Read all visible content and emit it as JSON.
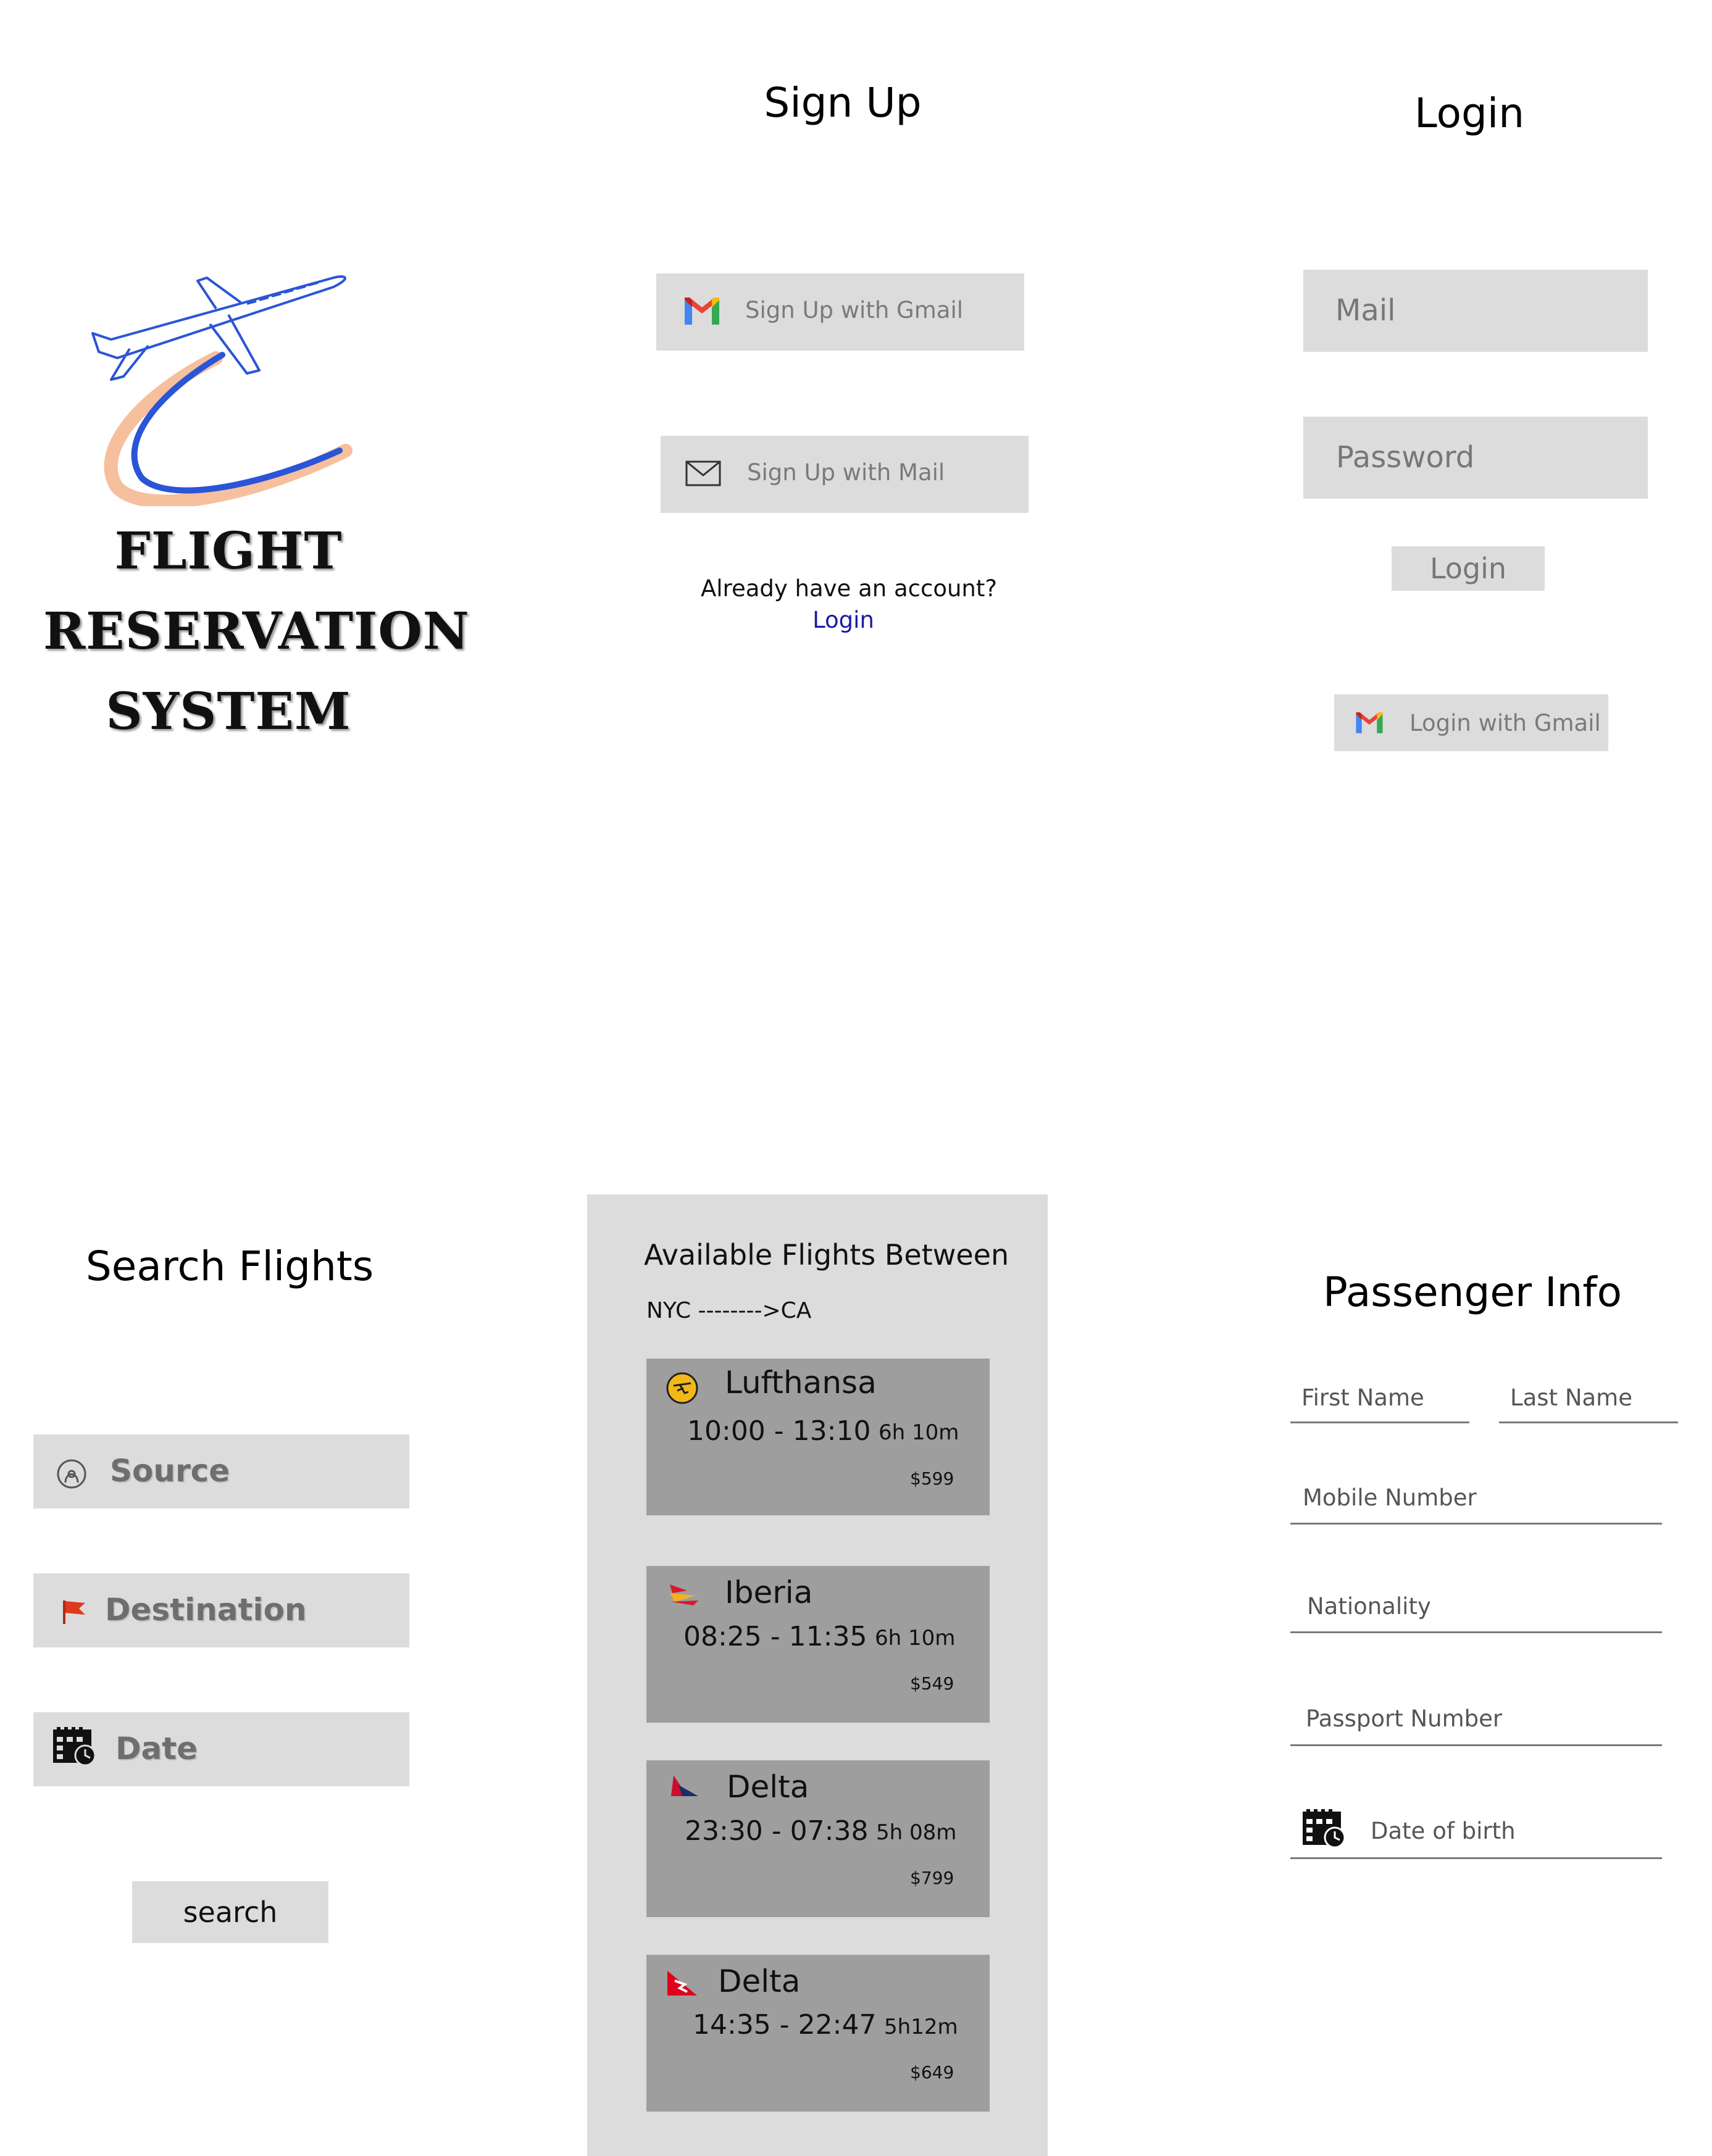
{
  "brand": {
    "line1": "FLIGHT",
    "line2": "RESERVATION",
    "line3": "SYSTEM"
  },
  "signup": {
    "title": "Sign Up",
    "gmail_label": "Sign Up with Gmail",
    "mail_label": "Sign Up with Mail",
    "already_text": "Already have an account?",
    "login_link": "Login"
  },
  "login": {
    "title": "Login",
    "mail_placeholder": "Mail",
    "password_placeholder": "Password",
    "login_button": "Login",
    "gmail_label": "Login with Gmail"
  },
  "search": {
    "title": "Search Flights",
    "source_label": "Source",
    "destination_label": "Destination",
    "date_label": "Date",
    "search_button": "search"
  },
  "flights": {
    "heading": "Available Flights Between",
    "route": "NYC -------->CA",
    "items": [
      {
        "airline": "Lufthansa",
        "times": "10:00 - 13:10",
        "duration": "6h 10m",
        "price": "$599",
        "icon": "lufthansa-logo-icon"
      },
      {
        "airline": "Iberia",
        "times": "08:25 - 11:35",
        "duration": "6h 10m",
        "price": "$549",
        "icon": "iberia-logo-icon"
      },
      {
        "airline": "Delta",
        "times": "23:30 - 07:38",
        "duration": "5h 08m",
        "price": "$799",
        "icon": "delta-logo-icon"
      },
      {
        "airline": "Delta",
        "times": "14:35 - 22:47",
        "duration": "5h12m",
        "price": "$649",
        "icon": "qantas-logo-icon"
      }
    ]
  },
  "passenger": {
    "title": "Passenger Info",
    "first_name": "First Name",
    "last_name": "Last Name",
    "mobile": "Mobile Number",
    "nationality": "Nationality",
    "passport": "Passport Number",
    "dob": "Date of birth"
  },
  "colors": {
    "panel_gray": "#dcdcdc",
    "card_gray": "#9e9e9e",
    "link_blue": "#1a1aa6",
    "flag_red": "#e03a1e"
  }
}
